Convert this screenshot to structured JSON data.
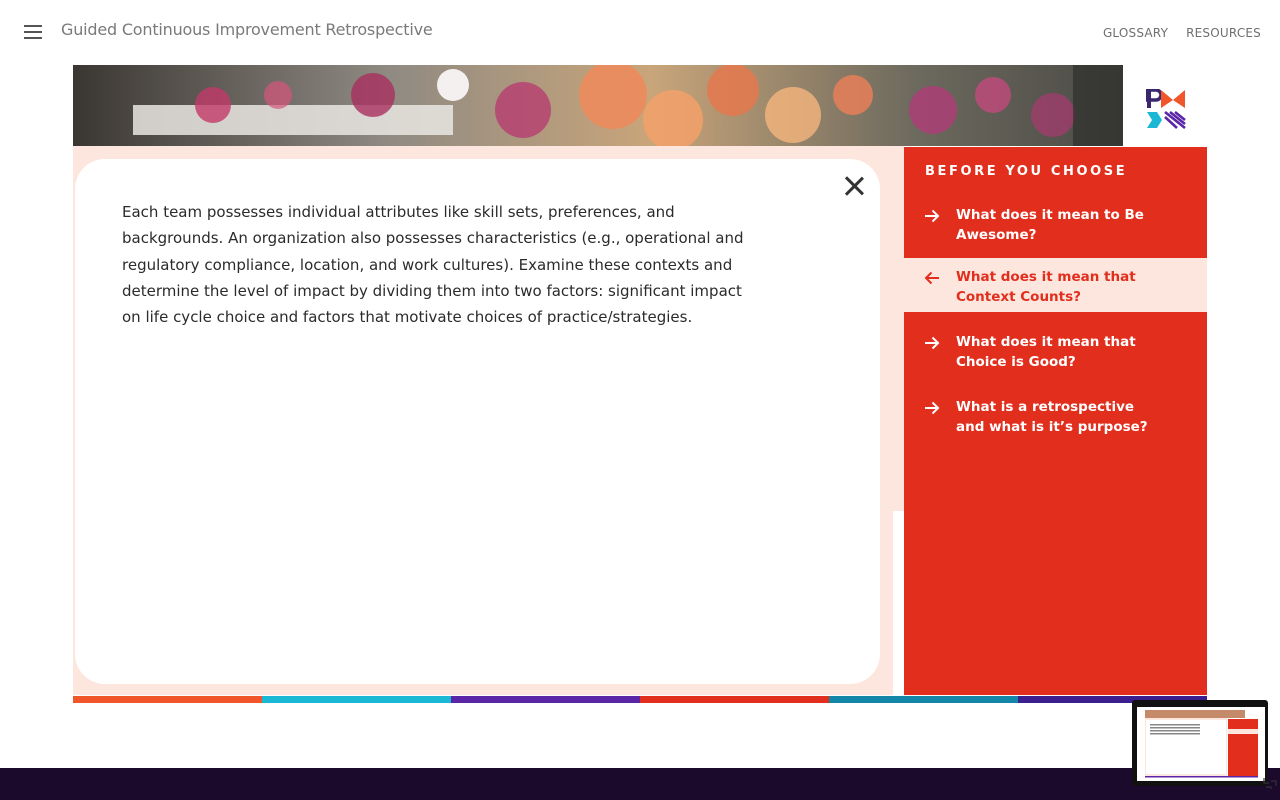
{
  "header": {
    "menu_icon": "hamburger-icon",
    "title": "Guided Continuous Improvement Retrospective",
    "nav": [
      {
        "label": "GLOSSARY"
      },
      {
        "label": "RESOURCES"
      }
    ]
  },
  "logo": {
    "icon": "pmi-logo-icon"
  },
  "modal": {
    "close_icon": "close-icon",
    "body": "Each team possesses individual attributes like skill sets, preferences, and backgrounds. An organization also possesses characteristics (e.g., operational and regulatory compliance, location, and work cultures). Examine these contexts and determine the level of impact by dividing them into two factors: significant impact on life cycle choice and factors that motivate choices of practice/strategies."
  },
  "sidebar": {
    "title": "BEFORE YOU CHOOSE",
    "items": [
      {
        "label": "What does it mean to Be Awesome?",
        "icon": "arrow-right-icon",
        "active": false
      },
      {
        "label": "What does it mean that Context Counts?",
        "icon": "arrow-left-icon",
        "active": true
      },
      {
        "label": "What does it mean that Choice is Good?",
        "icon": "arrow-right-icon",
        "active": false
      },
      {
        "label": "What is a retrospective and what is it’s purpose?",
        "icon": "arrow-right-icon",
        "active": false
      }
    ]
  },
  "stripe_colors": [
    "#f0562a",
    "#1bb8d6",
    "#5b25a8",
    "#e12e1d",
    "#1487a8",
    "#3b1f8f"
  ],
  "colors": {
    "accent": "#e12e1d",
    "peach": "#fde6dd",
    "footer": "#1b0a2b"
  },
  "minimap": {
    "icon": "resize-icon"
  }
}
